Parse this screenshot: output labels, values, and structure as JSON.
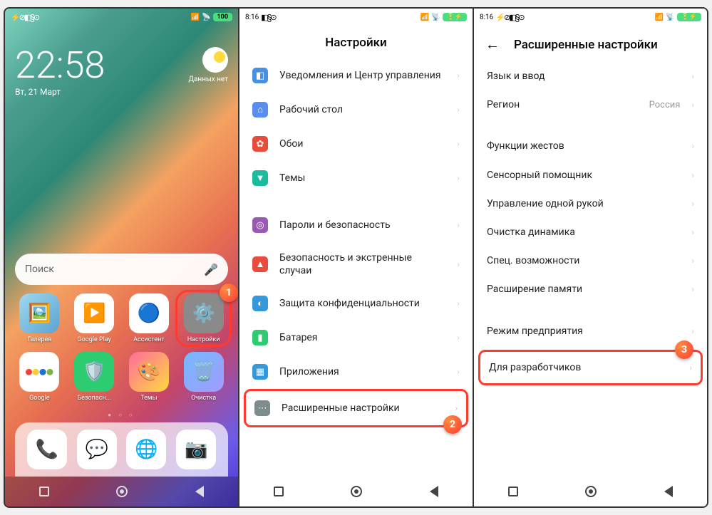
{
  "screen1": {
    "status": {
      "icons": "⚡⊘◧§⊙",
      "signal": "📶",
      "wifi": "📡",
      "battery": "100"
    },
    "clock": "22:58",
    "date": "Вт, 21 Март",
    "weather": "Данных нет",
    "search_placeholder": "Поиск",
    "badge": "1",
    "apps": {
      "gallery": "Галерея",
      "play": "Google Play",
      "assistant": "Ассистент",
      "settings": "Настройки",
      "google": "Google",
      "security": "Безопасн...",
      "themes": "Темы",
      "cleaner": "Очистка"
    }
  },
  "screen2": {
    "status_time": "8:16",
    "status_icons": "◧§⊙",
    "title": "Настройки",
    "badge": "2",
    "items": {
      "notifications": "Уведомления и Центр управления",
      "desktop": "Рабочий стол",
      "wallpaper": "Обои",
      "themes": "Темы",
      "passwords": "Пароли и безопасность",
      "emergency": "Безопасность и экстренные случаи",
      "privacy": "Защита конфиденциальности",
      "battery": "Батарея",
      "apps": "Приложения",
      "advanced": "Расширенные настройки"
    }
  },
  "screen3": {
    "status_time": "8:16",
    "status_icons": "⚡⊘◧§⊙",
    "title": "Расширенные настройки",
    "badge": "3",
    "items": {
      "lang": "Язык и ввод",
      "region": "Регион",
      "region_value": "Россия",
      "gestures": "Функции жестов",
      "touch": "Сенсорный помощник",
      "onehand": "Управление одной рукой",
      "speaker": "Очистка динамика",
      "accessibility": "Спец. возможности",
      "memory": "Расширение памяти",
      "enterprise": "Режим предприятия",
      "developer": "Для разработчиков"
    }
  }
}
